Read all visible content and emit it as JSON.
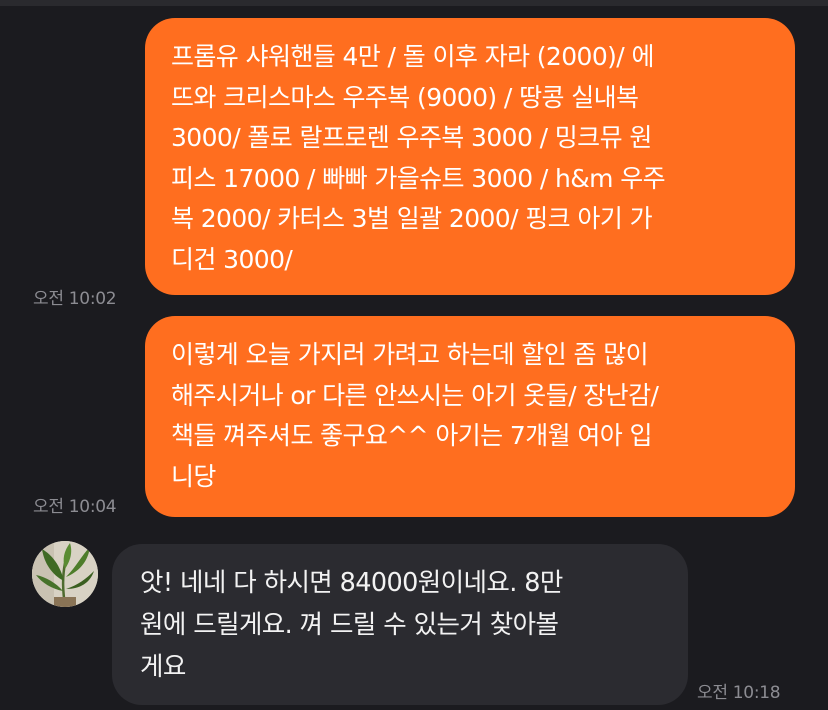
{
  "messages": [
    {
      "direction": "outgoing",
      "text": "프롬유 샤워핸들 4만 /  돌 이후 자라 (2000)/ 에\n뜨와 크리스마스 우주복 (9000) / 땅콩 실내복\n3000/ 폴로 랄프로렌 우주복 3000 / 밍크뮤 원\n피스 17000 / 빠빠 가을슈트 3000 / h&m 우주\n복 2000/ 카터스 3벌 일괄 2000/ 핑크 아기 가\n디건 3000/",
      "time": "오전 10:02"
    },
    {
      "direction": "outgoing",
      "text": "이렇게 오늘 가지러 가려고 하는데 할인 좀 많이\n해주시거나 or 다른 안쓰시는 아기 옷들/ 장난감/\n책들 껴주셔도 좋구요^^ 아기는 7개월 여아 입\n니당",
      "time": "오전 10:04"
    },
    {
      "direction": "incoming",
      "text": "앗! 네네 다 하시면 84000원이네요. 8만\n원에 드릴게요. 껴 드릴 수 있는거 찾아볼\n게요",
      "time": "오전 10:18"
    }
  ],
  "colors": {
    "background": "#1b1b1f",
    "outgoing_bubble": "#ff6e1f",
    "incoming_bubble": "#2b2b30",
    "timestamp": "#8c8c92"
  },
  "avatar": {
    "icon": "plant-avatar-icon"
  }
}
